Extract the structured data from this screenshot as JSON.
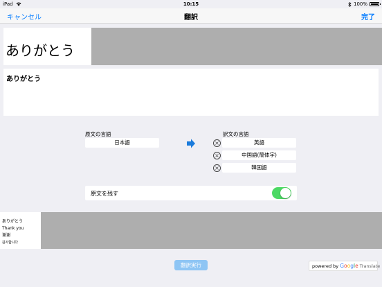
{
  "status": {
    "carrier": "iPad",
    "time": "10:15",
    "battery": "100%",
    "battery_level": 1.0
  },
  "nav": {
    "cancel": "キャンセル",
    "title": "翻訳",
    "done": "完了"
  },
  "source_text": "ありがとう",
  "input_text": "ありがとう",
  "source_lang": {
    "label": "原文の言語",
    "value": "日本語"
  },
  "target_lang": {
    "label": "訳文の言語",
    "items": [
      "英語",
      "中国語(簡体字)",
      "韓国語"
    ]
  },
  "keep_original": {
    "label": "原文を残す",
    "on": true
  },
  "result": {
    "lines": [
      "ありがとう",
      "Thank you",
      "谢谢",
      "감사합니다"
    ]
  },
  "run_button": "翻訳実行",
  "powered_by": {
    "prefix": "powered by",
    "brand": [
      "G",
      "o",
      "o",
      "g",
      "l",
      "e"
    ],
    "suffix": "Translate"
  },
  "colors": {
    "accent": "#007aff",
    "toggle_on": "#4cd964",
    "run_button": "#8ec5f4",
    "panel_gray": "#aeaeae"
  }
}
